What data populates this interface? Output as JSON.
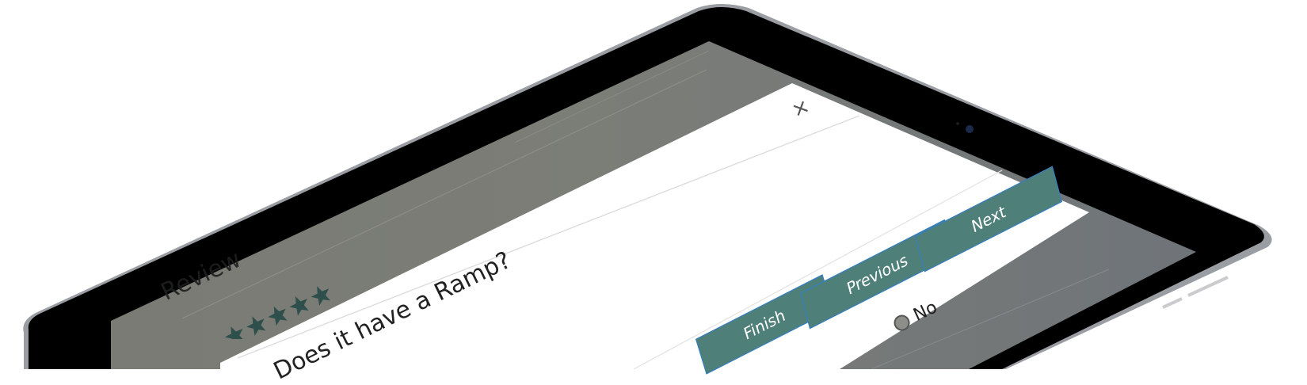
{
  "background_page": {
    "review_heading": "Review",
    "stars_filled": 5,
    "stars_total": 5,
    "star_color": "#2f4f4c"
  },
  "modal": {
    "close_label": "×",
    "question": "Does it have a Ramp?",
    "answer_options": [
      {
        "label": "No",
        "selected": false
      }
    ],
    "buttons": {
      "finish": "Finish",
      "previous": "Previous",
      "next": "Next"
    },
    "button_color": "#4e8079",
    "button_border_color": "#2f7fd1"
  },
  "device": {
    "bezel_color": "#000000",
    "frame_color": "#9a9ea3"
  }
}
